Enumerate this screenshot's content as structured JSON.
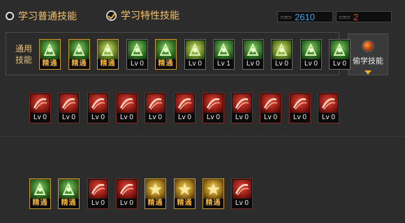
{
  "tabs": [
    {
      "label": "学习普通技能",
      "selected": false
    },
    {
      "label": "学习特性技能",
      "selected": true
    }
  ],
  "counters": [
    {
      "value": "2610",
      "color": "#3da5e6",
      "icon": "book-icon"
    },
    {
      "value": "2",
      "color": "#e0432c",
      "icon": "book-icon"
    }
  ],
  "common_row": {
    "label": "通用技能",
    "skills": [
      {
        "level": "精通",
        "mastered": true,
        "icon": "rest-icon"
      },
      {
        "level": "精通",
        "mastered": true,
        "icon": "kick-icon"
      },
      {
        "level": "精通",
        "mastered": true,
        "icon": "dash-icon"
      },
      {
        "level": "Lv 0",
        "mastered": false,
        "icon": "wings-icon"
      },
      {
        "level": "精通",
        "mastered": true,
        "icon": "target-icon"
      },
      {
        "level": "Lv 0",
        "mastered": false,
        "icon": "crosshair-icon"
      },
      {
        "level": "Lv 1",
        "mastered": false,
        "icon": "tree-icon"
      },
      {
        "level": "Lv 0",
        "mastered": false,
        "icon": "charge-icon"
      },
      {
        "level": "Lv 0",
        "mastered": false,
        "icon": "spiral-icon"
      },
      {
        "level": "Lv 0",
        "mastered": false,
        "icon": "muscle-icon"
      },
      {
        "level": "Lv 0",
        "mastered": false,
        "icon": "claw-icon"
      }
    ]
  },
  "steal_button": {
    "label": "偷学技能"
  },
  "red_row": {
    "skills": [
      {
        "level": "Lv 0",
        "mastered": false,
        "icon": "fighter-icon"
      },
      {
        "level": "Lv 0",
        "mastered": false,
        "icon": "slash-icon"
      },
      {
        "level": "Lv 0",
        "mastered": false,
        "icon": "slash-icon"
      },
      {
        "level": "Lv 0",
        "mastered": false,
        "icon": "arrows-icon"
      },
      {
        "level": "Lv 0",
        "mastered": false,
        "icon": "claw-icon"
      },
      {
        "level": "Lv 0",
        "mastered": false,
        "icon": "shield-icon"
      },
      {
        "level": "Lv 0",
        "mastered": false,
        "icon": "slash-icon"
      },
      {
        "level": "Lv 0",
        "mastered": false,
        "icon": "swirl-icon"
      },
      {
        "level": "Lv 0",
        "mastered": false,
        "icon": "bird-icon"
      },
      {
        "level": "Lv 0",
        "mastered": false,
        "icon": "burst-icon"
      },
      {
        "level": "Lv 0",
        "mastered": false,
        "icon": "swift-icon"
      }
    ]
  },
  "bottom_row": {
    "skills": [
      {
        "level": "精通",
        "mastered": true,
        "icon": "blade-icon",
        "art": "green"
      },
      {
        "level": "精通",
        "mastered": true,
        "icon": "whirl-icon",
        "art": "green"
      },
      {
        "level": "Lv 0",
        "mastered": false,
        "icon": "leaf-icon",
        "art": "red"
      },
      {
        "level": "Lv 0",
        "mastered": false,
        "icon": "blast-icon",
        "art": "red"
      },
      {
        "level": "精通",
        "mastered": true,
        "icon": "spear-icon",
        "art": "gold"
      },
      {
        "level": "精通",
        "mastered": true,
        "icon": "burst-icon",
        "art": "gold"
      },
      {
        "level": "精通",
        "mastered": true,
        "icon": "warrior-icon",
        "art": "gold"
      },
      {
        "level": "Lv 0",
        "mastered": false,
        "icon": "slash-icon",
        "art": "red"
      }
    ]
  }
}
